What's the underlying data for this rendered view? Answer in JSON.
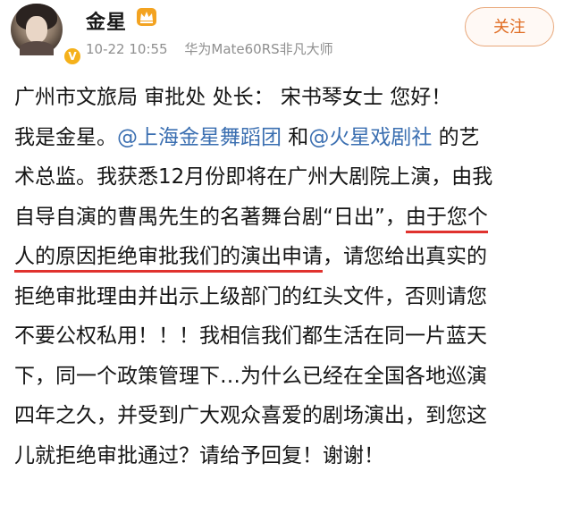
{
  "header": {
    "username": "金星",
    "verified_badge": "V",
    "timestamp": "10-22 10:55",
    "device": "华为Mate60RS非凡大师",
    "follow_label": "关注"
  },
  "post": {
    "line1": "广州市文旅局 审批处 处长： 宋书琴女士 您好！",
    "line2_a": "我是金星。",
    "mention1": "@上海金星舞蹈团",
    "line2_b": " 和",
    "mention2": "@火星戏剧社",
    "line2_c": " 的艺",
    "line3": "术总监。我获悉12月份即将在广州大剧院上演，由我",
    "line4_a": "自导自演的曹禺先生的名著舞台剧“日出”，",
    "line4_underlined": "由于您个",
    "line5_underlined": "人的原因拒绝审批我们的演出申请",
    "line5_b": "，请您给出真实的",
    "line6": "拒绝审批理由并出示上级部门的红头文件，否则请您",
    "line7": "不要公权私用！！！我相信我们都生活在同一片蓝天",
    "line8": "下，同一个政策管理下…为什么已经在全国各地巡演",
    "line9": "四年之久，并受到广大观众喜爱的剧场演出，到您这",
    "line10": "儿就拒绝审批通过？请给予回复！谢谢！"
  },
  "colors": {
    "mention": "#3b6fb1",
    "underline": "#e0322e",
    "follow": "#e06c22",
    "meta": "#8f8f8f"
  },
  "icons": [
    "avatar",
    "verified-badge-icon",
    "crown-icon"
  ]
}
